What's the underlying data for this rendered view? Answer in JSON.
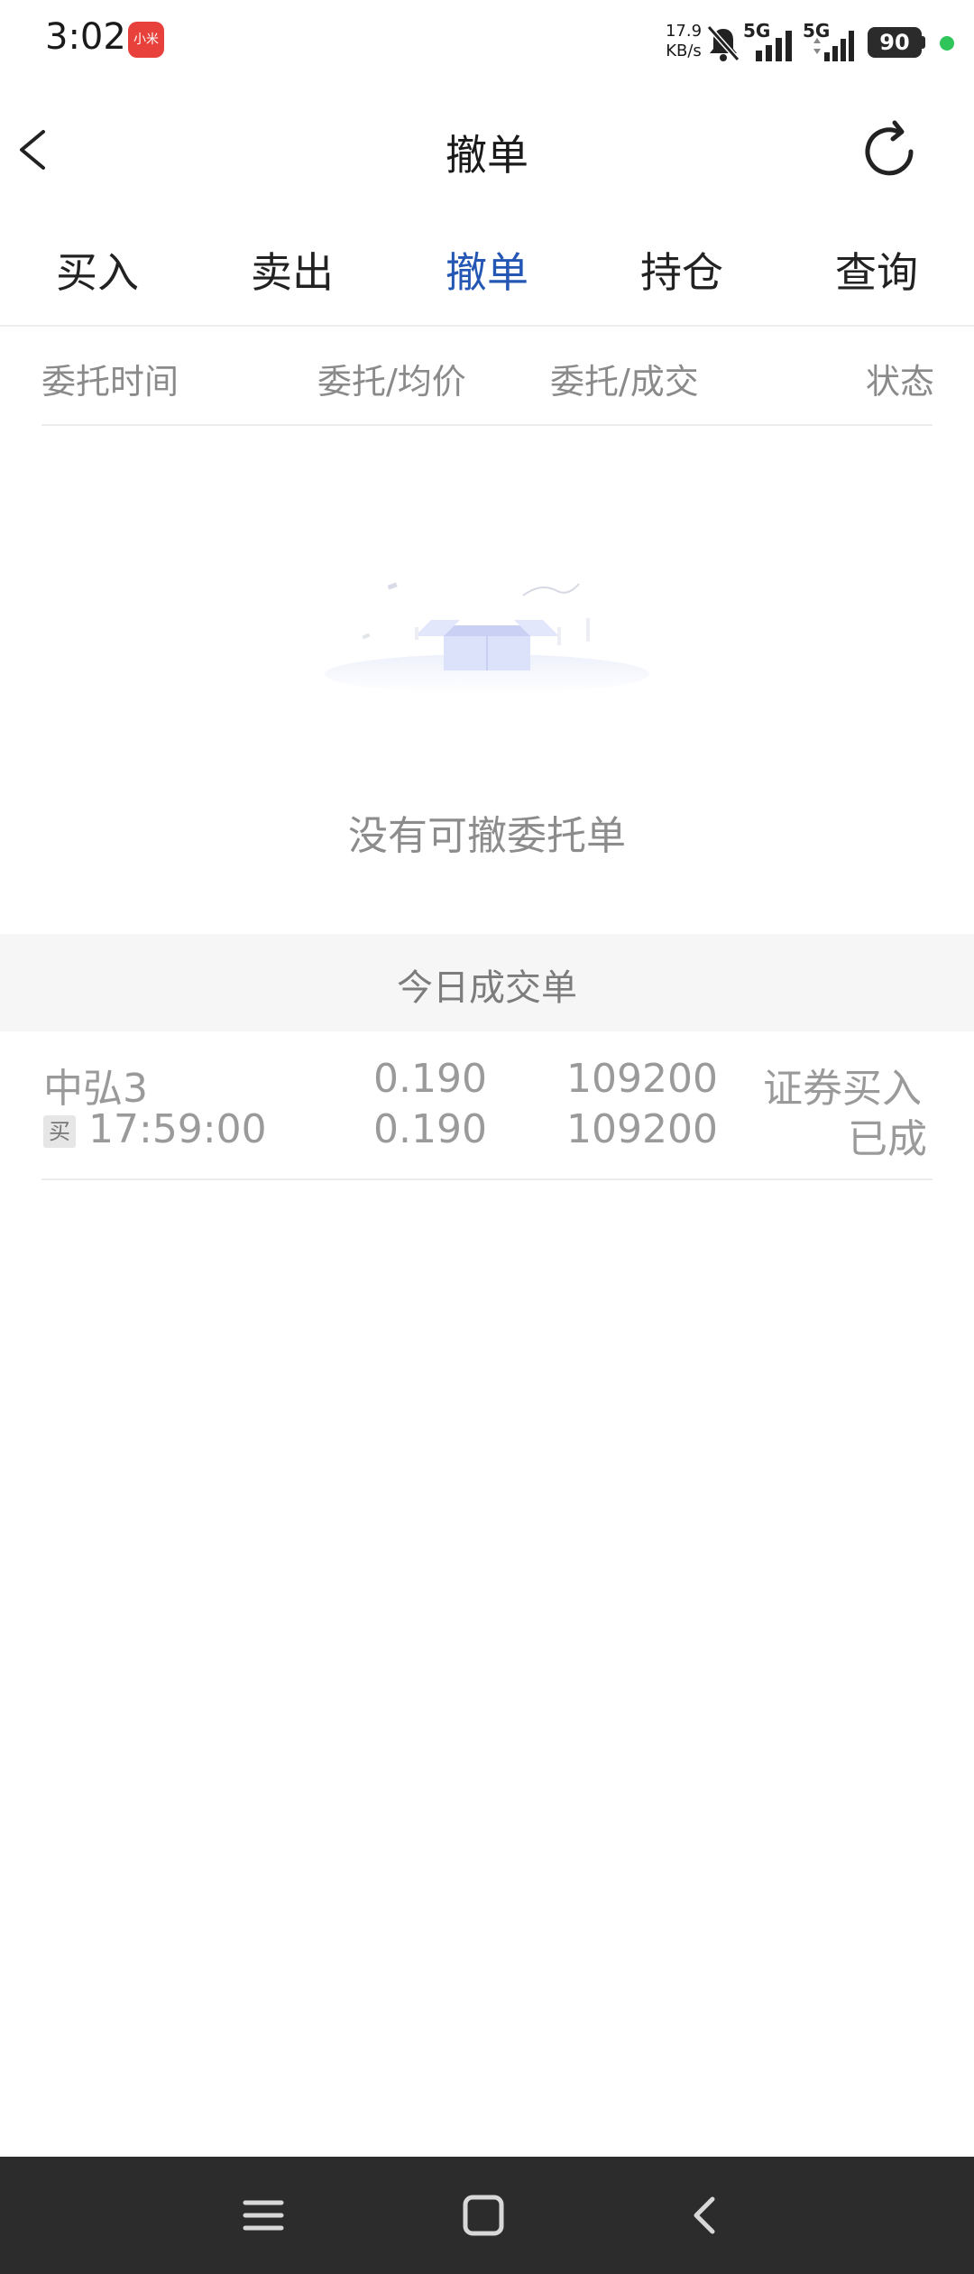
{
  "status_bar": {
    "time": "3:02",
    "app_icon_label": "小米",
    "net_speed_value": "17.9",
    "net_speed_unit": "KB/s",
    "signal_1_label": "5G",
    "signal_2_label": "5G",
    "battery": "90",
    "icons": [
      "mute-bell-icon",
      "signal-icon",
      "signal-icon",
      "battery-icon"
    ]
  },
  "header": {
    "title": "撤单",
    "icons": [
      "back-arrow-icon",
      "refresh-icon"
    ]
  },
  "tabs": [
    {
      "label": "买入",
      "active": false
    },
    {
      "label": "卖出",
      "active": false
    },
    {
      "label": "撤单",
      "active": true
    },
    {
      "label": "持仓",
      "active": false
    },
    {
      "label": "查询",
      "active": false
    }
  ],
  "columns": [
    "委托时间",
    "委托/均价",
    "委托/成交",
    "状态"
  ],
  "empty_state": {
    "message": "没有可撤委托单",
    "icon": "empty-box-icon"
  },
  "today_section": {
    "title": "今日成交单",
    "rows": [
      {
        "name": "中弘3",
        "side_tag": "买",
        "time": "17:59:00",
        "order_price": "0.190",
        "avg_price": "0.190",
        "order_qty": "109200",
        "deal_qty": "109200",
        "type": "证券买入",
        "status": "已成"
      }
    ]
  },
  "nav_bar": {
    "icons": [
      "menu-icon",
      "home-square-icon",
      "back-triangle-icon"
    ]
  },
  "colors": {
    "accent": "#2456b4",
    "text_muted": "#9a9a9a",
    "nav_bg": "#2c2c2c"
  }
}
